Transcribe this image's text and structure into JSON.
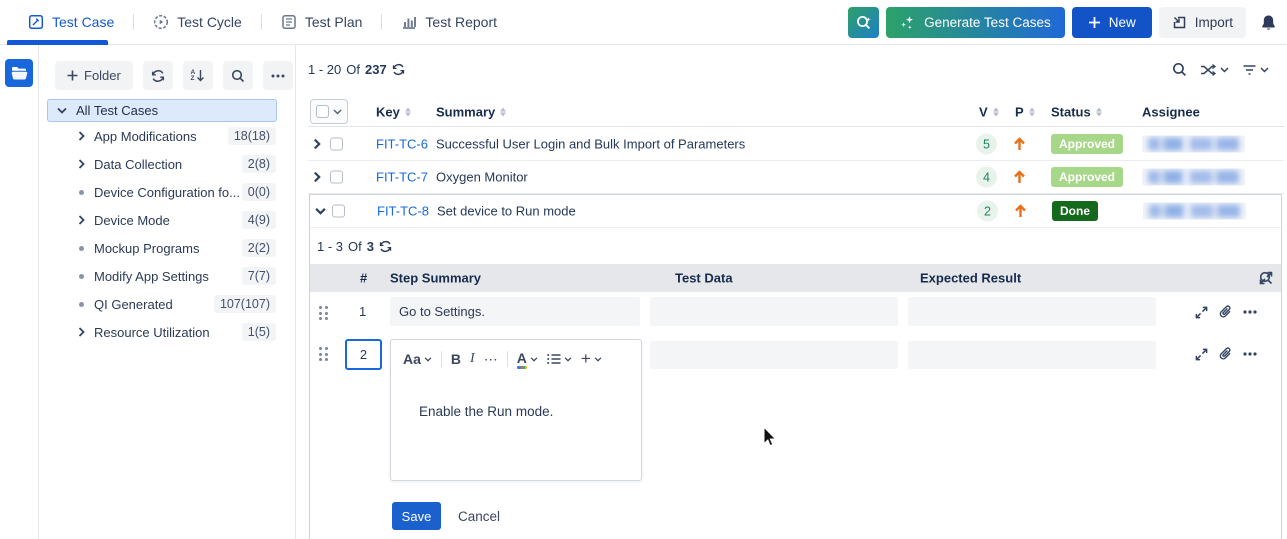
{
  "nav": {
    "tabs": [
      {
        "label": "Test Case",
        "active": true
      },
      {
        "label": "Test Cycle",
        "active": false
      },
      {
        "label": "Test Plan",
        "active": false
      },
      {
        "label": "Test Report",
        "active": false
      }
    ],
    "generate_button": "Generate Test Cases",
    "new_button": "New",
    "import_button": "Import"
  },
  "sidebar": {
    "add_folder_button": "Folder",
    "root_item": "All Test Cases",
    "items": [
      {
        "label": "App Modifications",
        "count": "18(18)",
        "type": "expandable"
      },
      {
        "label": "Data Collection",
        "count": "2(8)",
        "type": "expandable"
      },
      {
        "label": "Device Configuration fo...",
        "count": "0(0)",
        "type": "leaf"
      },
      {
        "label": "Device Mode",
        "count": "4(9)",
        "type": "expandable"
      },
      {
        "label": "Mockup Programs",
        "count": "2(2)",
        "type": "leaf"
      },
      {
        "label": "Modify App Settings",
        "count": "7(7)",
        "type": "leaf"
      },
      {
        "label": "QI Generated",
        "count": "107(107)",
        "type": "leaf"
      },
      {
        "label": "Resource Utilization",
        "count": "1(5)",
        "type": "expandable"
      }
    ]
  },
  "list": {
    "range": "1 - 20",
    "of_label": "Of",
    "total": "237",
    "headers": {
      "key": "Key",
      "summary": "Summary",
      "v": "V",
      "p": "P",
      "status": "Status",
      "assignee": "Assignee"
    },
    "rows": [
      {
        "key": "FIT-TC-6",
        "summary": "Successful User Login and Bulk Import of Parameters",
        "version": "5",
        "status": "Approved",
        "assignee_blurred": true,
        "expanded": false
      },
      {
        "key": "FIT-TC-7",
        "summary": "Oxygen Monitor",
        "version": "4",
        "status": "Approved",
        "assignee_blurred": true,
        "expanded": false
      },
      {
        "key": "FIT-TC-8",
        "summary": "Set device to Run mode",
        "version": "2",
        "status": "Done",
        "assignee_blurred": true,
        "expanded": true
      }
    ]
  },
  "steps": {
    "range": "1 - 3",
    "of_label": "Of",
    "total": "3",
    "headers": {
      "num": "#",
      "summary": "Step Summary",
      "test_data": "Test Data",
      "expected": "Expected Result"
    },
    "rows": [
      {
        "num": "1",
        "summary": "Go to Settings.",
        "test_data": "",
        "expected": ""
      }
    ],
    "editor": {
      "num_value": "2",
      "content": "Enable the Run mode.",
      "toolbar": {
        "text_style": "Aa",
        "bold": "B",
        "italic": "I",
        "more": "⋯",
        "color": "A",
        "plus": "+"
      },
      "save_label": "Save",
      "cancel_label": "Cancel"
    }
  },
  "colors": {
    "accent_blue": "#1558d6",
    "link_blue": "#1868db",
    "status_approved_bg": "#a7d889",
    "status_done_bg": "#15691d",
    "priority_high": "#e8701a",
    "version_badge_bg": "#e8f3ec",
    "version_badge_text": "#1f845a"
  }
}
